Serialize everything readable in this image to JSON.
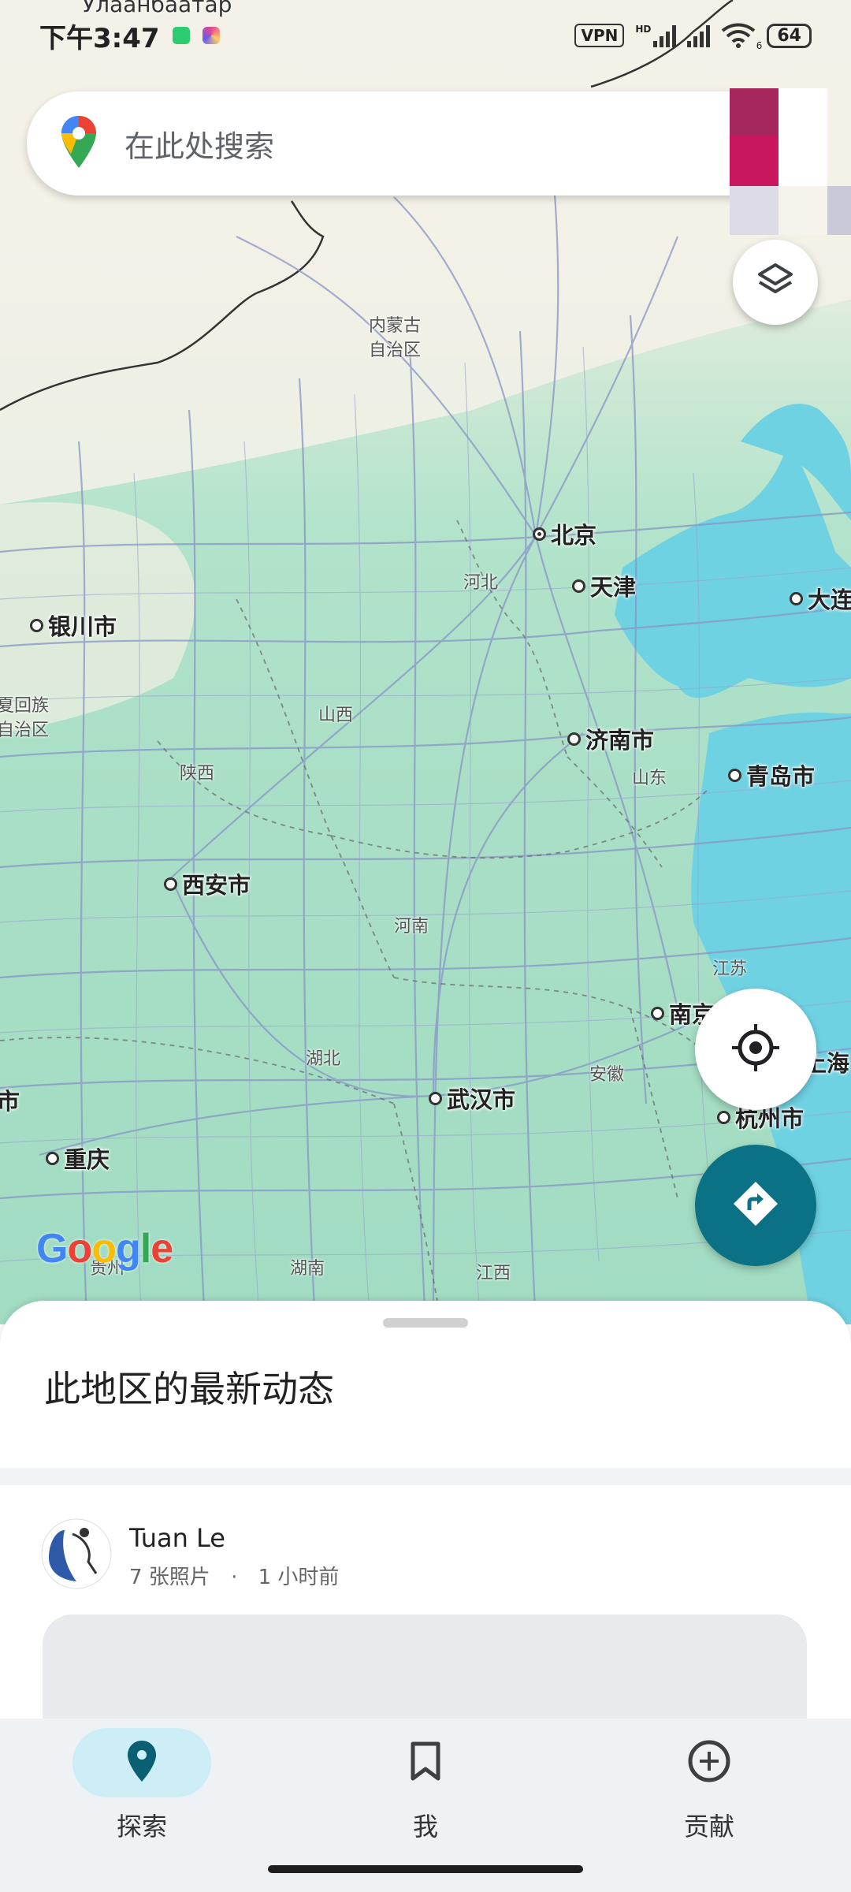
{
  "status_bar": {
    "time": "下午3:47",
    "vpn": "VPN",
    "network": "HD",
    "wifi_badge": "6",
    "battery": "64"
  },
  "search": {
    "placeholder": "在此处搜索"
  },
  "map": {
    "top_label": "Улаанбаатар",
    "cities": {
      "beijing": "北京",
      "tianjin": "天津",
      "dalian": "大连",
      "yinchuan": "银川市",
      "jinan": "济南市",
      "qingdao": "青岛市",
      "xian": "西安市",
      "nanjing": "南京",
      "shanghai": "上海",
      "wuhan": "武汉市",
      "hangzhou": "杭州市",
      "chongqing": "重庆",
      "left_cut": "市"
    },
    "provinces": {
      "neimenggu": "内蒙古\n自治区",
      "hebei": "河北",
      "ningxia": "夏回族\n自治区",
      "shanxi": "山西",
      "shaanxi": "陕西",
      "shandong": "山东",
      "henan": "河南",
      "jiangsu": "江苏",
      "hubei": "湖北",
      "anhui": "安徽",
      "guizhou": "贵州",
      "hunan": "湖南",
      "jiangxi": "江西"
    },
    "google": "Google",
    "water_color": "#6fd2e2",
    "land_color": "#a9dfc6"
  },
  "sheet": {
    "title": "此地区的最新动态",
    "post": {
      "author": "Tuan Le",
      "photos": "7 张照片",
      "separator": "·",
      "time": "1 小时前"
    }
  },
  "nav": {
    "explore": "探索",
    "me": "我",
    "contribute": "贡献",
    "active_color": "#cdeef6",
    "icon_color": "#0b5f72"
  },
  "colors": {
    "directions_fab": "#0b7285",
    "accent": "#0b5f72"
  }
}
